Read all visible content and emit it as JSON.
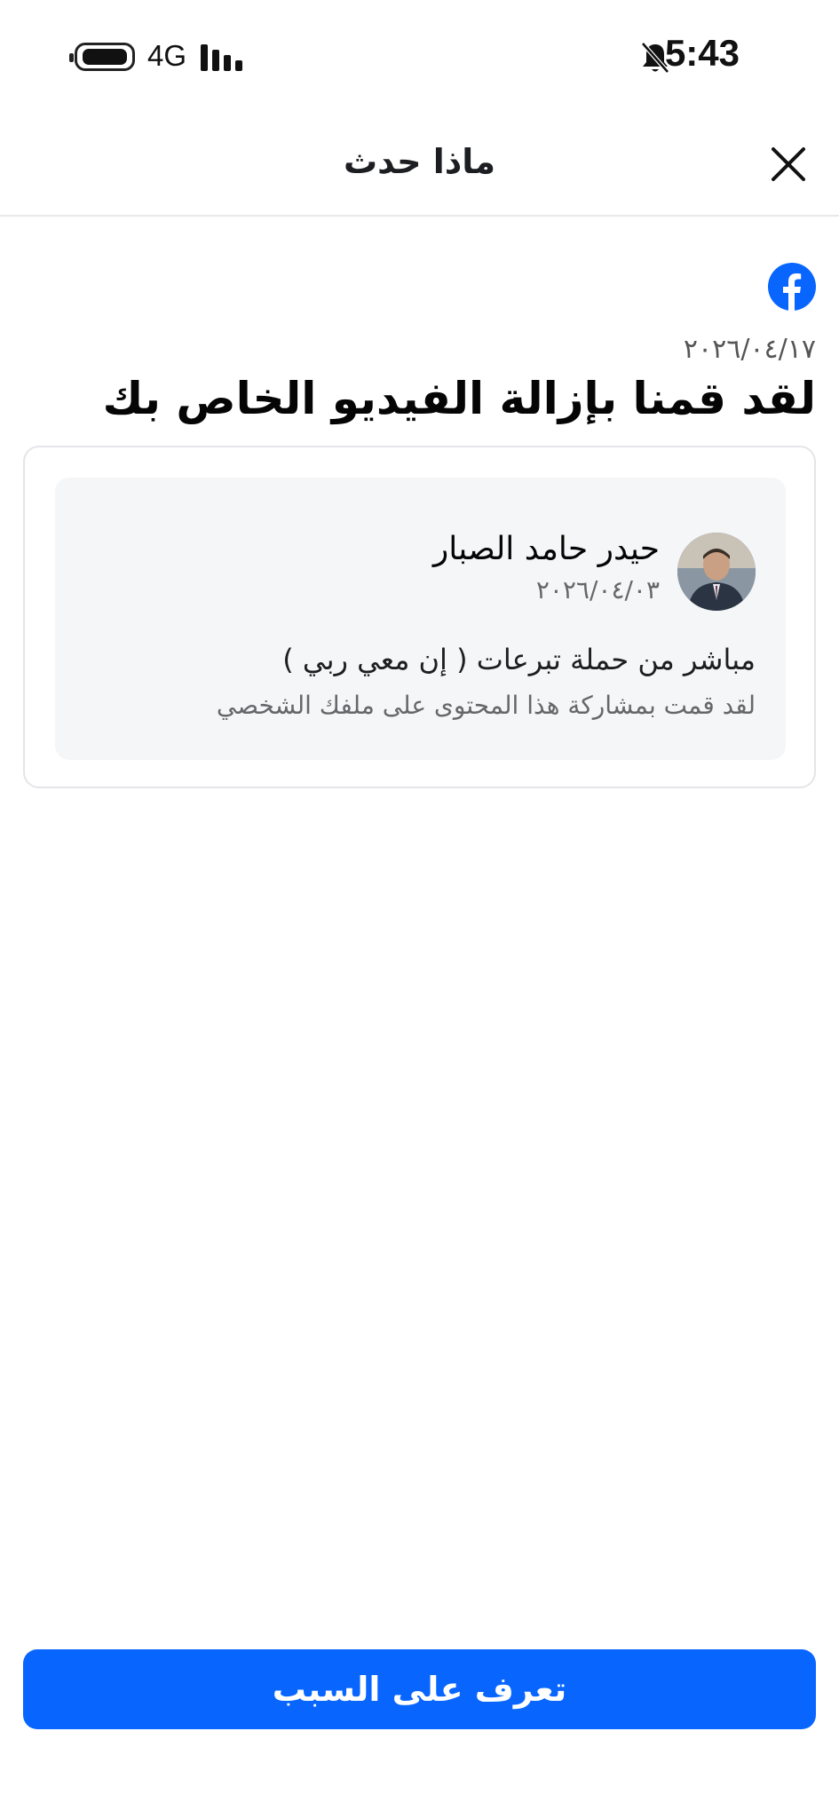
{
  "status_bar": {
    "network": "4G",
    "time": "5:43",
    "icons": [
      "battery-icon",
      "signal-icon",
      "bell-off-icon"
    ]
  },
  "header": {
    "title": "ماذا حدث",
    "close_icon": "close-icon"
  },
  "notice": {
    "logo_icon": "facebook-logo-icon",
    "date": "٢٠٢٦/٠٤/١٧",
    "title": "لقد قمنا بإزالة الفيديو الخاص بك"
  },
  "post": {
    "author": "حيدر حامد الصبار",
    "date": "٢٠٢٦/٠٤/٠٣",
    "text": "مباشر من حملة تبرعات ( إن معي ربي )",
    "shared_note": "لقد قمت بمشاركة هذا المحتوى على ملفك الشخصي"
  },
  "cta": {
    "label": "تعرف على السبب"
  },
  "colors": {
    "accent": "#0866ff",
    "facebook_blue": "#0866ff",
    "card_bg": "#f5f6f8",
    "secondary_text": "#65676b"
  }
}
